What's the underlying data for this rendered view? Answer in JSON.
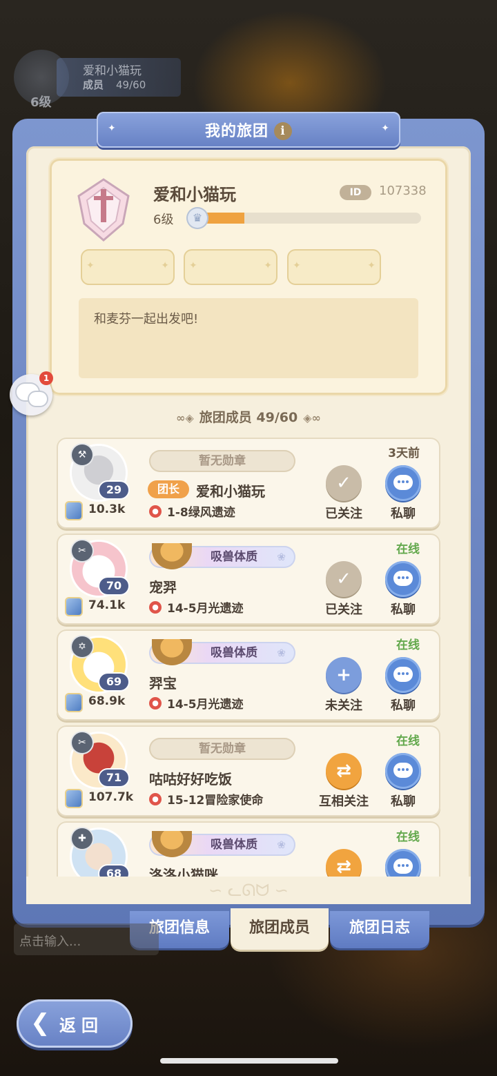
{
  "header_guild": {
    "name": "爱和小猫玩",
    "members_label": "成员",
    "members_count": "49/60",
    "level": "6级"
  },
  "panel": {
    "title": "我的旅团"
  },
  "guild": {
    "name": "爱和小猫玩",
    "id_label": "ID",
    "id": "107338",
    "level": "6级",
    "xp_fraction": 0.21,
    "motto": "和麦芬一起出发吧!"
  },
  "side_chat": {
    "badge": "1"
  },
  "members_header": "旅团成员 49/60",
  "members": [
    {
      "level": "29",
      "power": "10.3k",
      "medal": "暂无勋章",
      "has_medal": false,
      "role": "团长",
      "name": "爱和小猫玩",
      "location": "1-8绿风遗迹",
      "status": "3天前",
      "online": false,
      "follow": "已关注",
      "follow_state": "done",
      "chat": "私聊"
    },
    {
      "level": "70",
      "power": "74.1k",
      "medal": "吸兽体质",
      "has_medal": true,
      "role": "",
      "name": "宠羿",
      "location": "14-5月光遗迹",
      "status": "在线",
      "online": true,
      "follow": "已关注",
      "follow_state": "done",
      "chat": "私聊"
    },
    {
      "level": "69",
      "power": "68.9k",
      "medal": "吸兽体质",
      "has_medal": true,
      "role": "",
      "name": "羿宝",
      "location": "14-5月光遗迹",
      "status": "在线",
      "online": true,
      "follow": "未关注",
      "follow_state": "add",
      "chat": "私聊"
    },
    {
      "level": "71",
      "power": "107.7k",
      "medal": "暂无勋章",
      "has_medal": false,
      "role": "",
      "name": "咕咕好好吃饭",
      "location": "15-12冒险家使命",
      "status": "在线",
      "online": true,
      "follow": "互相关注",
      "follow_state": "mutual",
      "chat": "私聊"
    },
    {
      "level": "68",
      "power": "",
      "medal": "吸兽体质",
      "has_medal": true,
      "role": "",
      "name": "洛洛小猫咪",
      "location": "",
      "status": "在线",
      "online": true,
      "follow": "",
      "follow_state": "mutual",
      "chat": ""
    }
  ],
  "tabs": [
    {
      "label": "旅团信息",
      "active": false
    },
    {
      "label": "旅团成员",
      "active": true
    },
    {
      "label": "旅团日志",
      "active": false
    }
  ],
  "input": {
    "placeholder": "点击输入..."
  },
  "back": {
    "label": "返回"
  },
  "colors": {
    "accent_blue": "#6680c4",
    "online_green": "#62a84c",
    "xp_orange": "#efa240",
    "leader_orange": "#f0a14a"
  }
}
